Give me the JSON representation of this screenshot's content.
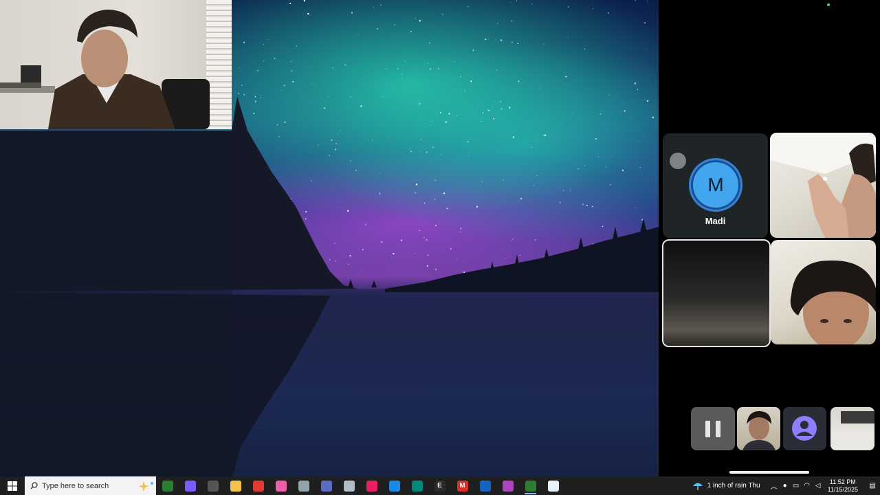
{
  "wallpaper": {
    "description_free": true
  },
  "call": {
    "participant_name": "Madi",
    "participant_initial": "M",
    "colors": {
      "avatar": "#42a6ef",
      "ring": "#1c4f8e",
      "tile": "#1f2427"
    }
  },
  "taskbar": {
    "search_placeholder": "Type here to search",
    "icons": [
      {
        "name": "task-manager-icon",
        "glyph": "",
        "color": "#2e7d32"
      },
      {
        "name": "copilot-icon",
        "glyph": "",
        "color": "#7b5cff"
      },
      {
        "name": "screen-tool-icon",
        "glyph": "",
        "color": "#555555"
      },
      {
        "name": "file-explorer-icon",
        "glyph": "",
        "color": "#f2c14e"
      },
      {
        "name": "chrome-icon",
        "glyph": "",
        "color": "#e53935"
      },
      {
        "name": "itunes-icon",
        "glyph": "",
        "color": "#ef5fa7"
      },
      {
        "name": "remote-desktop-icon",
        "glyph": "",
        "color": "#90a4ae"
      },
      {
        "name": "chrome-profile-icon",
        "glyph": "",
        "color": "#5c6bc0"
      },
      {
        "name": "game-app-icon",
        "glyph": "",
        "color": "#b0bec5"
      },
      {
        "name": "photos-icon",
        "glyph": "",
        "color": "#e91e63"
      },
      {
        "name": "todo-icon",
        "glyph": "",
        "color": "#1e88e5"
      },
      {
        "name": "edge-icon",
        "glyph": "",
        "color": "#00897b"
      },
      {
        "name": "epic-games-icon",
        "glyph": "E",
        "color": "#2b2b2b"
      },
      {
        "name": "gmail-icon",
        "glyph": "M",
        "color": "#d93025"
      },
      {
        "name": "outlook-icon",
        "glyph": "",
        "color": "#1565c0"
      },
      {
        "name": "copilot-pro-icon",
        "glyph": "",
        "color": "#ab47bc"
      },
      {
        "name": "phone-link-icon",
        "glyph": "",
        "color": "#2e7d32"
      },
      {
        "name": "settings-app-icon",
        "glyph": "",
        "color": "#e3f2fd"
      }
    ],
    "weather": "1 inch of rain Thu",
    "time": "11:52 PM",
    "date": "11/15/2025"
  }
}
